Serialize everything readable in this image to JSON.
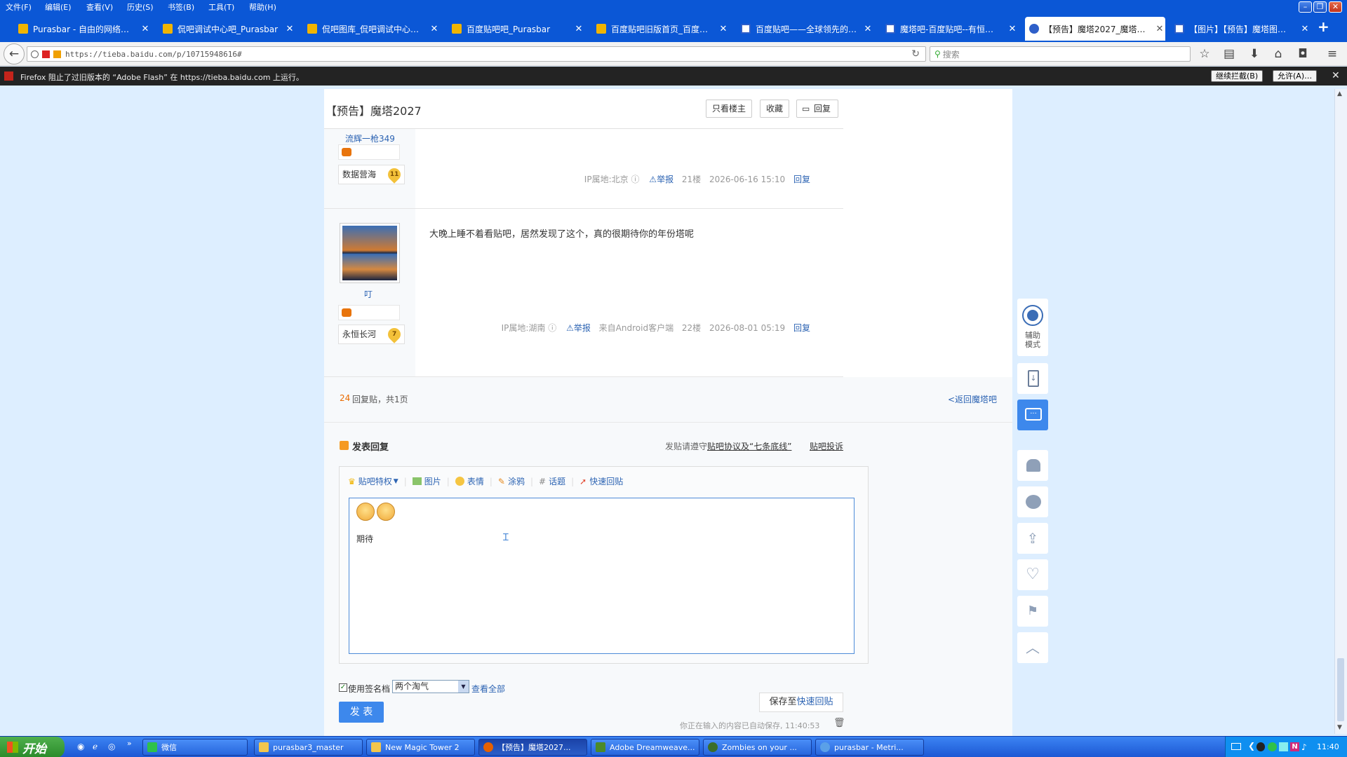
{
  "menubar": {
    "items": [
      "文件(F)",
      "编辑(E)",
      "查看(V)",
      "历史(S)",
      "书签(B)",
      "工具(T)",
      "帮助(H)"
    ]
  },
  "tabs": [
    {
      "title": "Purasbar - 自由的网络…",
      "active": false
    },
    {
      "title": "侃吧调试中心吧_Purasbar",
      "active": false
    },
    {
      "title": "侃吧图库_侃吧调试中心…",
      "active": false
    },
    {
      "title": "百度贴吧吧_Purasbar",
      "active": false
    },
    {
      "title": "百度贴吧旧版首页_百度…",
      "active": false
    },
    {
      "title": "百度贴吧——全球领先的…",
      "active": false
    },
    {
      "title": "魔塔吧-百度贴吧--有恒…",
      "active": false
    },
    {
      "title": "【预告】魔塔2027_魔塔…",
      "active": true
    },
    {
      "title": "【图片】【预告】魔塔图…",
      "active": false
    }
  ],
  "nav": {
    "url": "https://tieba.baidu.com/p/10715948616#",
    "search_placeholder": "搜索"
  },
  "flashbar": {
    "message": "Firefox 阻止了过旧版本的 “Adobe Flash” 在 https://tieba.baidu.com 上运行。",
    "continue_block": "继续拦截(B)",
    "allow": "允许(A)…"
  },
  "thread": {
    "title": "【预告】魔塔2027",
    "only_op": "只看楼主",
    "favorite": "收藏",
    "reply": "回复"
  },
  "posts": [
    {
      "username": "流辉一枪349",
      "badge_name": "数据营海",
      "badge_level": "11",
      "content": "",
      "ip": "IP属地:北京",
      "report": "举报",
      "client": "",
      "floor": "21楼",
      "time": "2026-06-16 15:10",
      "reply": "回复"
    },
    {
      "username": "叮",
      "badge_name": "永恒长河",
      "badge_level": "7",
      "content": "大晚上睡不着看贴吧，居然发现了这个，真的很期待你的年份塔呢",
      "ip": "IP属地:湖南",
      "report": "举报",
      "client": "来自Android客户端",
      "floor": "22楼",
      "time": "2026-08-01 05:19",
      "reply": "回复"
    }
  ],
  "pager": {
    "count": "24",
    "text": "回复贴，共1页",
    "back": "<返回魔塔吧"
  },
  "editor": {
    "heading": "发表回复",
    "rules_prefix": "发贴请遵守",
    "rules_link": "贴吧协议及“七条底线”",
    "complaint": "贴吧投诉",
    "toolbar": [
      "贴吧特权",
      "图片",
      "表情",
      "涂鸦",
      "话题",
      "快速回贴"
    ],
    "content": "期待",
    "signature_label": "使用签名档",
    "signature_value": "两个淘气",
    "view_all": "查看全部",
    "submit": "发 表",
    "save_prefix": "保存至",
    "save_link": "快速回贴",
    "autosave": "你正在输入的内容已自动保存, 11:40:53"
  },
  "rightbar": {
    "assist": "辅助模式"
  },
  "taskbar": {
    "start": "开始",
    "tasks": [
      {
        "label": "微信",
        "active": false
      },
      {
        "label": "purasbar3_master",
        "active": false
      },
      {
        "label": "New Magic Tower 2",
        "active": false
      },
      {
        "label": "【预告】魔塔2027...",
        "active": true
      },
      {
        "label": "Adobe Dreamweave...",
        "active": false
      },
      {
        "label": "Zombies on your ...",
        "active": false
      },
      {
        "label": "purasbar - Metri...",
        "active": false
      }
    ],
    "clock": "11:40"
  }
}
